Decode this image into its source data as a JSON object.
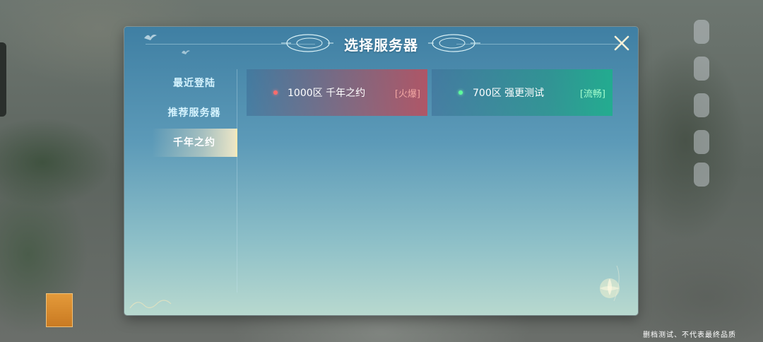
{
  "dialog": {
    "title": "选择服务器",
    "close_icon": "close-x-icon"
  },
  "nav": {
    "items": [
      {
        "label": "最近登陆",
        "active": false
      },
      {
        "label": "推荐服务器",
        "active": false
      },
      {
        "label": "千年之约",
        "active": true
      }
    ]
  },
  "servers": [
    {
      "name": "1000区 千年之约",
      "status": "[火爆]",
      "state": "hot",
      "dot_color": "#ff6b6b"
    },
    {
      "name": "700区 强更测试",
      "status": "[流畅]",
      "state": "smooth",
      "dot_color": "#5dff9b"
    }
  ],
  "footer": {
    "note": "删档测试、不代表最终品质"
  },
  "colors": {
    "panel_top": "#3f7fa3",
    "panel_bottom": "#b8d9cf",
    "hot": "#b9505f",
    "smooth": "#1eaf8c",
    "active_tab": "#f4e9b6"
  }
}
